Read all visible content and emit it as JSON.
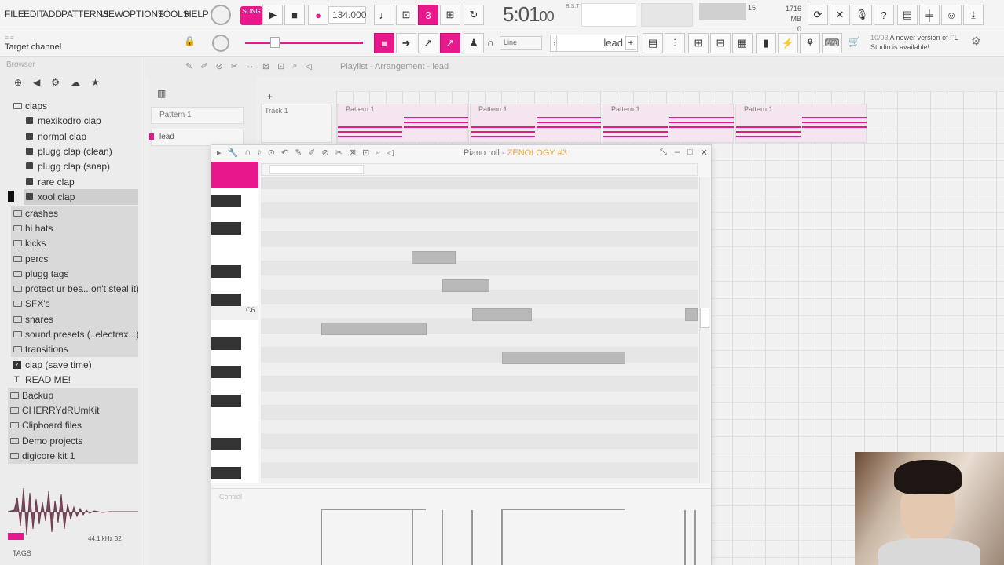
{
  "menu": [
    "FILE",
    "EDIT",
    "ADD",
    "PATTERNS",
    "VIEW",
    "OPTIONS",
    "TOOLS",
    "HELP"
  ],
  "transport": {
    "song_toggle": "SONG",
    "tempo": "134.000",
    "time": "5:01",
    "time_sub": "00",
    "time_unit": "B:S:T",
    "polyphony": "15",
    "memory": "1716 MB",
    "memory_sub": "0"
  },
  "toolbar2": {
    "hint_label": "Target channel",
    "line_mode": "Line",
    "pattern_name": "lead",
    "news_date": "10/03",
    "news_text": "A newer version of FL Studio is available!"
  },
  "browser": {
    "title": "Browser",
    "items": [
      {
        "label": "claps",
        "type": "folder",
        "level": 0
      },
      {
        "label": "mexikodro clap",
        "type": "sample",
        "level": 1
      },
      {
        "label": "normal clap",
        "type": "sample",
        "level": 1
      },
      {
        "label": "plugg clap (clean)",
        "type": "sample",
        "level": 1
      },
      {
        "label": "plugg clap (snap)",
        "type": "sample",
        "level": 1
      },
      {
        "label": "rare clap",
        "type": "sample",
        "level": 1
      },
      {
        "label": "xool clap",
        "type": "sample",
        "level": 1,
        "selected": true
      },
      {
        "label": "crashes",
        "type": "folder",
        "level": 0
      },
      {
        "label": "hi hats",
        "type": "folder",
        "level": 0
      },
      {
        "label": "kicks",
        "type": "folder",
        "level": 0
      },
      {
        "label": "percs",
        "type": "folder",
        "level": 0
      },
      {
        "label": "plugg tags",
        "type": "folder",
        "level": 0
      },
      {
        "label": "protect ur bea...on't steal it)",
        "type": "folder",
        "level": 0
      },
      {
        "label": "SFX's",
        "type": "folder",
        "level": 0
      },
      {
        "label": "snares",
        "type": "folder",
        "level": 0
      },
      {
        "label": "sound presets (..electrax...)",
        "type": "folder",
        "level": 0
      },
      {
        "label": "transitions",
        "type": "folder",
        "level": 0
      },
      {
        "label": "clap (save time)",
        "type": "check",
        "level": 0
      },
      {
        "label": "READ ME!",
        "type": "text",
        "level": 0
      },
      {
        "label": "Backup",
        "type": "folder",
        "level": -1
      },
      {
        "label": "CHERRYdRUmKit",
        "type": "folder",
        "level": -1
      },
      {
        "label": "Clipboard files",
        "type": "folder",
        "level": -1
      },
      {
        "label": "Demo projects",
        "type": "folder",
        "level": -1
      },
      {
        "label": "digicore kit 1",
        "type": "folder",
        "level": -1
      }
    ],
    "waveform_info": "44.1 kHz 32",
    "tags_label": "TAGS"
  },
  "playlist": {
    "breadcrumb": "Playlist - Arrangement - lead",
    "patterns": [
      "Pattern 1",
      "lead"
    ],
    "track_label": "Track 1",
    "clip_label": "Pattern 1",
    "clip_count": 4
  },
  "piano_roll": {
    "title_prefix": "Piano roll - ",
    "song_name": "ZENOLOGY #3",
    "key_label": "C6",
    "control_label": "Control"
  },
  "colors": {
    "accent": "#e6188c",
    "highlight": "#f0a33c"
  }
}
